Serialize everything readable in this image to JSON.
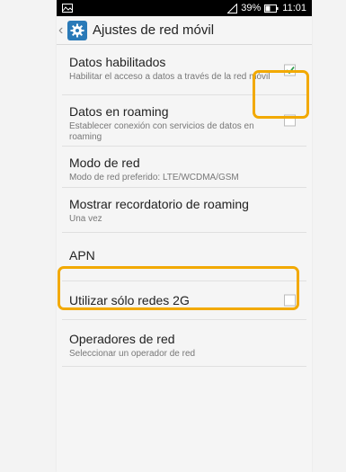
{
  "status_bar": {
    "battery": "39%",
    "time": "11:01",
    "signal_icon": "signal-triangle-icon",
    "battery_icon": "battery-icon",
    "gallery_icon": "image-notification-icon"
  },
  "action_bar": {
    "title": "Ajustes de red móvil",
    "app_icon": "settings-gear-icon"
  },
  "items": [
    {
      "title": "Datos habilitados",
      "subtitle": "Habilitar el acceso a datos a través de la red móvil",
      "checkbox": true,
      "checked": true
    },
    {
      "title": "Datos en roaming",
      "subtitle": "Establecer conexión con servicios de datos en roaming",
      "checkbox": true,
      "checked": false
    },
    {
      "title": "Modo de red",
      "subtitle": "Modo de red preferido: LTE/WCDMA/GSM",
      "checkbox": false
    },
    {
      "title": "Mostrar recordatorio de roaming",
      "subtitle": "Una vez",
      "checkbox": false
    },
    {
      "title": "APN",
      "subtitle": "",
      "checkbox": false
    },
    {
      "title": "Utilizar sólo redes 2G",
      "subtitle": "",
      "checkbox": true,
      "checked": false
    },
    {
      "title": "Operadores de red",
      "subtitle": "Seleccionar un operador de red",
      "checkbox": false
    }
  ],
  "colors": {
    "highlight": "#f2a900",
    "check": "#2e9d4a",
    "app_icon_bg": "#2a7ab8"
  }
}
